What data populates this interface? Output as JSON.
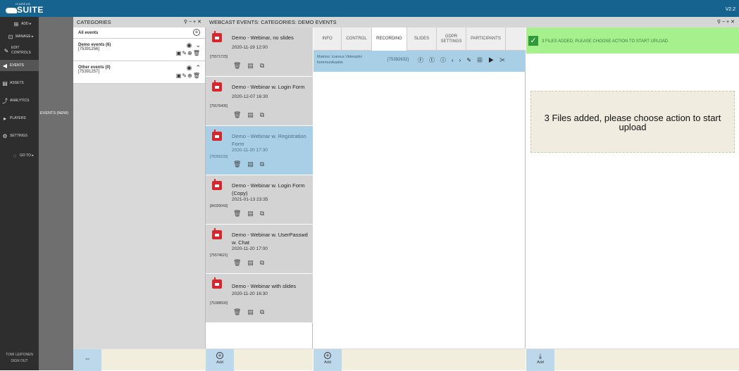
{
  "app": {
    "brand": "ICAREUS",
    "name": "SUITE",
    "version": "V2.2"
  },
  "sidebar": {
    "items": [
      {
        "label": "ADD",
        "icon": "plus-square-icon"
      },
      {
        "label": "MANAGE",
        "icon": "manage-icon"
      },
      {
        "label": "EDIT CONTROLS",
        "icon": "edit-icon"
      },
      {
        "label": "EVENTS",
        "icon": "megaphone-icon"
      },
      {
        "label": "ASSETS",
        "icon": "assets-icon"
      },
      {
        "label": "ANALYTICS",
        "icon": "chart-icon"
      },
      {
        "label": "PLAYERS",
        "icon": "play-circle-icon"
      },
      {
        "label": "SETTINGS",
        "icon": "gear-icon"
      },
      {
        "label": "GO TO",
        "icon": "goto-icon"
      }
    ],
    "user": "TOMI LEIPONEN",
    "signout": "SIGN OUT"
  },
  "subbar": {
    "label": "EVENTS (NEW)"
  },
  "categories": {
    "title": "CATEGORIES",
    "all_label": "All events",
    "items": [
      {
        "name": "Demo events (6)",
        "id": "[75391256]"
      },
      {
        "name": "Other events (0)",
        "id": "[75391257]"
      }
    ]
  },
  "events_panel": {
    "title": "WEBCAST EVENTS: CATEGORIES: DEMO EVENTS",
    "events": [
      {
        "title": "Demo - Webinar, no slides",
        "date": "2020-11-19 12:00",
        "id": "[75571723]"
      },
      {
        "title": "Demo - Webinar w. Login Form",
        "date": "2020-12-07 16:30",
        "id": "[75576405]"
      },
      {
        "title": "Demo - Webinar w. Registration Form",
        "date": "2020-11-20 17:30",
        "id": "[78355233]"
      },
      {
        "title": "Demo - Webinar w. Login Form (Copy)",
        "date": "2021-01-13 23:35",
        "id": "[84320043]"
      },
      {
        "title": "Demo - Webinar w. UserPasswd w. Chat",
        "date": "2020-11-20 17:00",
        "id": "[75574621]"
      },
      {
        "title": "Demo - Webinar with slides",
        "date": "2020-11-20 16:30",
        "id": "[75398500]"
      }
    ]
  },
  "tabs": [
    "INFO",
    "CONTROL",
    "RECORDING",
    "SLIDES",
    "GDPR SETTINGS",
    "PARTICIPANTS"
  ],
  "recording": {
    "name": "Mainos: Icareus Videopilvi kommunikaatio",
    "id": "[75392632]"
  },
  "upload": {
    "notice": "3 FILES ADDED, PLEASE CHOOSE ACTION TO START UPLOAD",
    "dropzone": "3 Files added, please choose action to start upload"
  },
  "footer": {
    "add_label": "Add"
  },
  "colors": {
    "topbar": "#17638f",
    "selected": "#a9cfe6",
    "notice": "#a6f08e",
    "calendar": "#d9262c"
  }
}
